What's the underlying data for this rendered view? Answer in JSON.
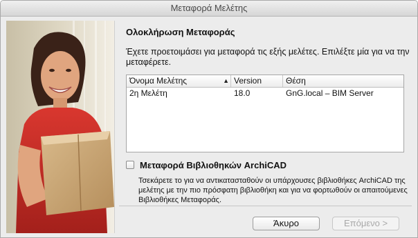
{
  "window": {
    "title": "Μεταφορά Μελέτης"
  },
  "main": {
    "heading": "Ολοκλήρωση Μεταφοράς",
    "description": "Έχετε προετοιμάσει για μεταφορά τις εξής μελέτες. Επιλέξτε μία για να την μεταφέρετε."
  },
  "table": {
    "columns": [
      "Όνομα Μελέτης",
      "Version",
      "Θέση"
    ],
    "sorted_column": "Όνομα Μελέτης",
    "rows": [
      {
        "name": "2η Μελέτη",
        "version": "18.0",
        "location": "GnG.local – BIM Server"
      }
    ]
  },
  "library_option": {
    "label": "Μεταφορά Βιβλιοθηκών ArchiCAD",
    "checked": false,
    "note": "Τσεκάρετε το για να αντικατασταθούν οι υπάρχουσες βιβλιοθήκες ArchiCAD της μελέτης με την πιο πρόσφατη βιβλιοθήκη και για να φορτωθούν οι απαιτούμενες Βιβλιοθήκες Μεταφοράς."
  },
  "buttons": {
    "cancel": "Άκυρο",
    "next": "Επόμενο >"
  }
}
